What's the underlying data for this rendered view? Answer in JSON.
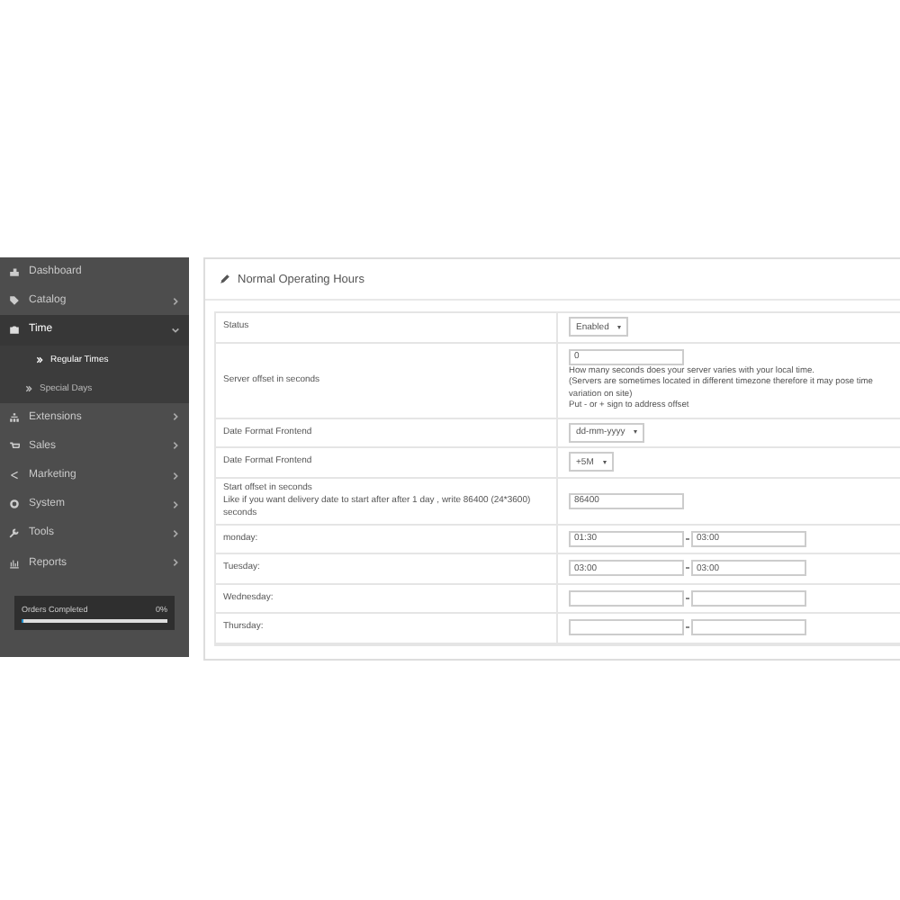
{
  "sidebar": {
    "items": [
      {
        "label": "Dashboard",
        "expanded": false,
        "has_arrow": false
      },
      {
        "label": "Catalog",
        "expanded": false,
        "has_arrow": true
      },
      {
        "label": "Time",
        "expanded": true,
        "has_arrow": true,
        "children": [
          {
            "label": "Regular Times",
            "selected": true
          },
          {
            "label": "Special Days",
            "selected": false
          }
        ]
      },
      {
        "label": "Extensions",
        "expanded": false,
        "has_arrow": true
      },
      {
        "label": "Sales",
        "expanded": false,
        "has_arrow": true
      },
      {
        "label": "Marketing",
        "expanded": false,
        "has_arrow": true
      },
      {
        "label": "System",
        "expanded": false,
        "has_arrow": true
      },
      {
        "label": "Tools",
        "expanded": false,
        "has_arrow": true
      },
      {
        "label": "Reports",
        "expanded": false,
        "has_arrow": true
      }
    ],
    "progress": {
      "label": "Orders Completed",
      "reading": "0%",
      "level": 0
    }
  },
  "panel": {
    "title": "Normal Operating Hours",
    "rows": [
      {
        "kind": "select",
        "label": "Status",
        "value": "Enabled"
      },
      {
        "kind": "input",
        "label": "Server offset in seconds",
        "value": "0",
        "help": [
          "How many seconds does your server varies with your local time.",
          "(Servers are sometimes located in different timezone therefore it may pose time variation on site)",
          "Put - or + sign to address offset"
        ]
      },
      {
        "kind": "select",
        "label": "Date Format Frontend",
        "value": "dd-mm-yyyy"
      },
      {
        "kind": "select",
        "label": "Date Format Frontend",
        "value": "+5M"
      },
      {
        "kind": "input",
        "label": "Start offset in seconds",
        "note": "Like if you want delivery date to start after after 1 day , write 86400 (24*3600) seconds",
        "value": "86400"
      },
      {
        "kind": "range",
        "label": "monday:",
        "from": "01:30",
        "to": "03:00"
      },
      {
        "kind": "range",
        "label": "Tuesday:",
        "from": "03:00",
        "to": "03:00"
      },
      {
        "kind": "range",
        "label": "Wednesday:"
      },
      {
        "kind": "range",
        "label": "Thursday:"
      }
    ]
  }
}
